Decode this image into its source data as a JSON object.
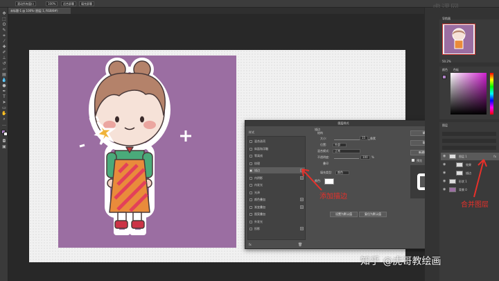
{
  "options_bar": {
    "btn1": "滚动所有窗口",
    "btn2": "100%",
    "btn3": "适合屏幕",
    "btn4": "填充屏幕"
  },
  "document_tab": "未标题-1 @ 100% (图层 1, RGB/8#)",
  "watermark_top": "虎课网",
  "dialog": {
    "title": "图层样式",
    "list_header": "样式",
    "list_items": [
      {
        "label": "混合选项",
        "checked": false,
        "plus": false,
        "selected": false
      },
      {
        "label": "斜面和浮雕",
        "checked": false,
        "plus": false,
        "selected": false
      },
      {
        "label": "等高线",
        "checked": false,
        "plus": false,
        "selected": false
      },
      {
        "label": "纹理",
        "checked": false,
        "plus": false,
        "selected": false
      },
      {
        "label": "描边",
        "checked": true,
        "plus": true,
        "selected": true
      },
      {
        "label": "内阴影",
        "checked": false,
        "plus": true,
        "selected": false
      },
      {
        "label": "内发光",
        "checked": false,
        "plus": false,
        "selected": false
      },
      {
        "label": "光泽",
        "checked": false,
        "plus": false,
        "selected": false
      },
      {
        "label": "颜色叠加",
        "checked": false,
        "plus": true,
        "selected": false
      },
      {
        "label": "渐变叠加",
        "checked": false,
        "plus": true,
        "selected": false
      },
      {
        "label": "图案叠加",
        "checked": false,
        "plus": false,
        "selected": false
      },
      {
        "label": "外发光",
        "checked": false,
        "plus": false,
        "selected": false
      },
      {
        "label": "投影",
        "checked": false,
        "plus": true,
        "selected": false
      }
    ],
    "section_title": "描边",
    "structure_label": "结构",
    "size_label": "大小:",
    "size_value": "15",
    "size_unit": "像素",
    "position_label": "位置:",
    "position_value": "外部",
    "blend_label": "混合模式:",
    "blend_value": "正常",
    "opacity_label": "不透明度:",
    "opacity_value": "100",
    "opacity_unit": "%",
    "overprint_label": "叠印",
    "fill_type_label": "填充类型:",
    "fill_type_value": "颜色",
    "color_label": "颜色:",
    "default_btn": "设置为默认值",
    "reset_btn": "复位为默认值",
    "ok": "确定",
    "cancel": "取消",
    "new_style": "新建样式...",
    "preview_label": "预览",
    "fx_label": "fx"
  },
  "navigator": {
    "title": "导航器",
    "zoom": "50.2%"
  },
  "color_panel": {
    "title": "颜色",
    "tab2": "色板"
  },
  "layers": {
    "title": "图层",
    "rows": [
      {
        "name": "图层 1",
        "selected": true,
        "fx": "fx"
      },
      {
        "name": "效果",
        "selected": false,
        "fx": ""
      },
      {
        "name": "描边",
        "selected": false,
        "fx": ""
      },
      {
        "name": "形状 1",
        "selected": false,
        "fx": ""
      },
      {
        "name": "背景 0",
        "selected": false,
        "fx": ""
      }
    ]
  },
  "annotations": {
    "add_stroke": "添加描边",
    "merge_layers": "合并图层"
  },
  "watermark": "知乎 @虎哥教绘画",
  "colors": {
    "accent_red": "#e8302a",
    "canvas_purple": "#9b6ea2"
  }
}
